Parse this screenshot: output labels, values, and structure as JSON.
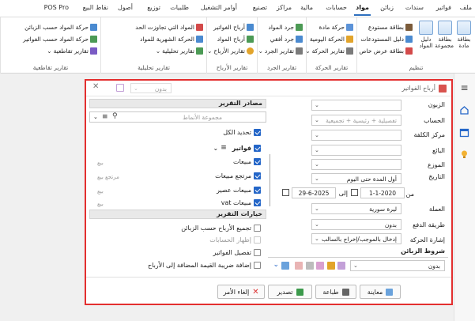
{
  "tabs": [
    "ملف",
    "فواتير",
    "سندات",
    "زبائن",
    "مواد",
    "حسابات",
    "مالية",
    "مراكز",
    "تصنيع",
    "أوامر التشغيل",
    "طلبيات",
    "توزيع",
    "أصول",
    "نقاط البيع",
    "POS Pro"
  ],
  "ribbon": {
    "organize": {
      "label": "تنظيم",
      "items": [
        "بطاقة مادة",
        "بطاقة مجموعة",
        "دليل المواد",
        "بطاقة مستودع",
        "دليل المستودعات",
        "بطاقة عرض خاص"
      ]
    },
    "movement": {
      "label": "تقارير الحركة",
      "items": [
        "حركة مادة",
        "الحركة اليومية",
        "تقارير الحركة"
      ]
    },
    "inventory": {
      "label": "تقارير الجرد",
      "items": [
        "جرد المواد",
        "جرد أفقي",
        "تقارير الجرد"
      ]
    },
    "profits": {
      "label": "تقارير الأرباح",
      "items": [
        "أرباح الفواتير",
        "أرباح المواد",
        "تقارير الأرباح"
      ]
    },
    "analytic": {
      "label": "تقارير تحليلية",
      "items": [
        "المواد التي تجاوزت الحد",
        "الحركة الشهرية للمواد",
        "تقارير تحليلية"
      ]
    },
    "cross": {
      "label": "تقارير تقاطعية",
      "items": [
        "حركة المواد حسب الزبائن",
        "حركة المواد حسب الفواتير",
        "تقارير تقاطعية"
      ]
    }
  },
  "dialog": {
    "title": "أرباح الفواتير",
    "title_placeholder": "بدون",
    "fields": {
      "customer": {
        "label": "الزبون",
        "value": ""
      },
      "account": {
        "label": "الحساب",
        "value": "تفصيلية + رئيسية + تجميعية"
      },
      "cost_center": {
        "label": "مركز الكلفة",
        "value": ""
      },
      "seller": {
        "label": "البائع",
        "value": ""
      },
      "distributor": {
        "label": "الموزع",
        "value": ""
      },
      "date": {
        "label": "التاريخ",
        "value": "أول المدة حتى اليوم"
      },
      "from_label": "من",
      "from_date": "1-1-2020",
      "to_label": "إلى",
      "to_date": "29-6-2025",
      "currency": {
        "label": "العملة",
        "value": "ليرة سورية"
      },
      "payment": {
        "label": "طريقة الدفع",
        "value": "بدون"
      },
      "movement_sign": {
        "label": "إشارة الحركة",
        "value": "إدخال بالموجب/إخراج بالسالب"
      }
    },
    "customer_conditions": {
      "label": "شروط الزبائن",
      "value": "بدون"
    },
    "sources": {
      "header": "مصادر التقرير",
      "search_placeholder": "مجموعة الأنماط",
      "refresh_all": "تحديد الكل",
      "group": "فواتير",
      "items": [
        {
          "name": "مبيعات",
          "type": "بيع"
        },
        {
          "name": "مرتجع مبيعات",
          "type": "مرتجع بيع"
        },
        {
          "name": "مبيعات عصير",
          "type": "بيع"
        },
        {
          "name": "مبيعات vat",
          "type": "بيع"
        }
      ]
    },
    "options": {
      "header": "خيارات التقرير",
      "items": [
        {
          "label": "تجميع الأرباح حسب الزبائن",
          "checked": false,
          "enabled": true
        },
        {
          "label": "إظهار الحسابات",
          "checked": false,
          "enabled": false
        },
        {
          "label": "تفصيل الفواتير",
          "checked": false,
          "enabled": true
        },
        {
          "label": "إضافة ضريبة القيمة المضافة إلى الأرباح",
          "checked": false,
          "enabled": true
        }
      ]
    },
    "buttons": {
      "preview": "معاينة",
      "print": "طباعة",
      "export": "تصدير",
      "cancel": "إلغاء الأمر"
    }
  },
  "colors": {
    "accent": "#2466c8",
    "frame": "#e32f2f"
  }
}
